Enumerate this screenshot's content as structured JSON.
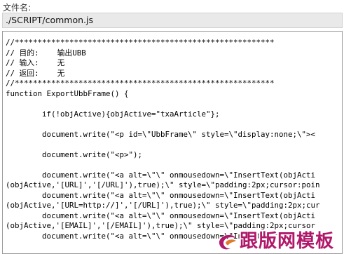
{
  "filename": {
    "label": "文件名:",
    "value": "./SCRIPT/common.js"
  },
  "editor": {
    "lines": [
      "//*********************************************************",
      "// 目的:    输出UBB",
      "// 输入:    无",
      "// 返回:    无",
      "//*********************************************************",
      "function ExportUbbFrame() {",
      "",
      "        if(!objActive){objActive=\"txaArticle\"};",
      "",
      "        document.write(\"<p id=\\\"UbbFrame\\\" style=\\\"display:none;\\\"><",
      "",
      "        document.write(\"<p>\");",
      "",
      "        document.write(\"<a alt=\\\"\\\" onmousedown=\\\"InsertText(objActi",
      "(objActive,'[URL]','[/URL]'),true);\\\" style=\\\"padding:2px;cursor:poin",
      "        document.write(\"<a alt=\\\"\\\" onmousedown=\\\"InsertText(objActi",
      "(objActive,'[URL=http://]','[/URL]'),true);\\\" style=\\\"padding:2px;cur",
      "        document.write(\"<a alt=\\\"\\\" onmousedown=\\\"InsertText(objActi",
      "(objActive,'[EMAIL]','[/EMAIL]'),true);\\\" style=\\\"padding:2px;cursor",
      "        document.write(\"<a alt=\\\"\\\" onmousedown=\\\"InsertText(objActi"
    ]
  },
  "watermark": {
    "text": "跟版网模板"
  },
  "colors": {
    "watermark": "#b0186a",
    "field_background": "#e9e9e9",
    "editor_border": "#9a9a9a"
  }
}
